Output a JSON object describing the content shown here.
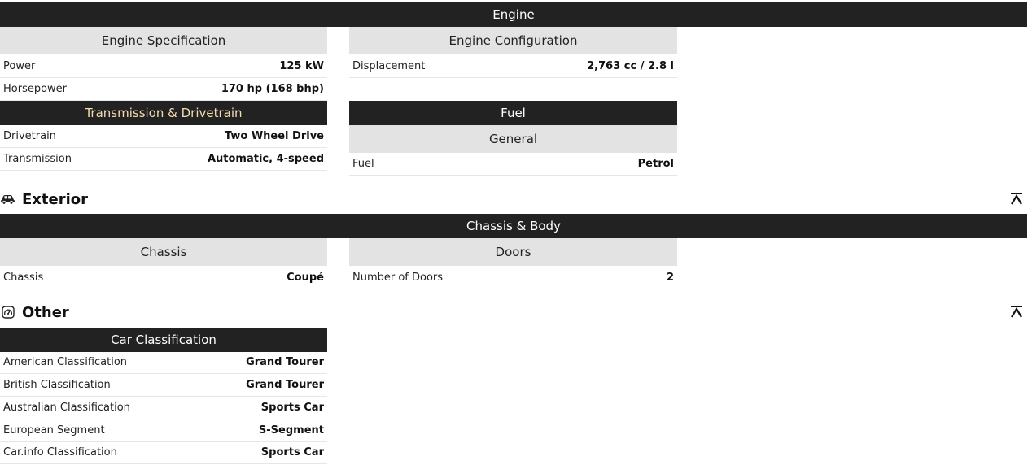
{
  "engine": {
    "header": "Engine",
    "spec": {
      "title": "Engine Specification",
      "rows": [
        {
          "label": "Power",
          "value": "125 kW"
        },
        {
          "label": "Horsepower",
          "value": "170 hp (168 bhp)"
        }
      ]
    },
    "config": {
      "title": "Engine Configuration",
      "rows": [
        {
          "label": "Displacement",
          "value": "2,763 cc / 2.8 l"
        }
      ]
    },
    "transmission": {
      "title": "Transmission & Drivetrain",
      "rows": [
        {
          "label": "Drivetrain",
          "value": "Two Wheel Drive"
        },
        {
          "label": "Transmission",
          "value": "Automatic, 4-speed"
        }
      ]
    },
    "fuel": {
      "title": "Fuel",
      "subtitle": "General",
      "rows": [
        {
          "label": "Fuel",
          "value": "Petrol"
        }
      ]
    }
  },
  "exterior": {
    "title": "Exterior",
    "icon": "car-icon",
    "header": "Chassis & Body",
    "chassis": {
      "title": "Chassis",
      "rows": [
        {
          "label": "Chassis",
          "value": "Coupé"
        }
      ]
    },
    "doors": {
      "title": "Doors",
      "rows": [
        {
          "label": "Number of Doors",
          "value": "2"
        }
      ]
    }
  },
  "other": {
    "title": "Other",
    "icon": "speedometer-icon",
    "classification": {
      "title": "Car Classification",
      "rows": [
        {
          "label": "American Classification",
          "value": "Grand Tourer"
        },
        {
          "label": "British Classification",
          "value": "Grand Tourer"
        },
        {
          "label": "Australian Classification",
          "value": "Sports Car"
        },
        {
          "label": "European Segment",
          "value": "S-Segment"
        },
        {
          "label": "Car.info Classification",
          "value": "Sports Car"
        }
      ]
    }
  },
  "colors": {
    "band": "#222222",
    "subheader": "#e3e3e3",
    "accent_text": "#f3dcb0"
  }
}
